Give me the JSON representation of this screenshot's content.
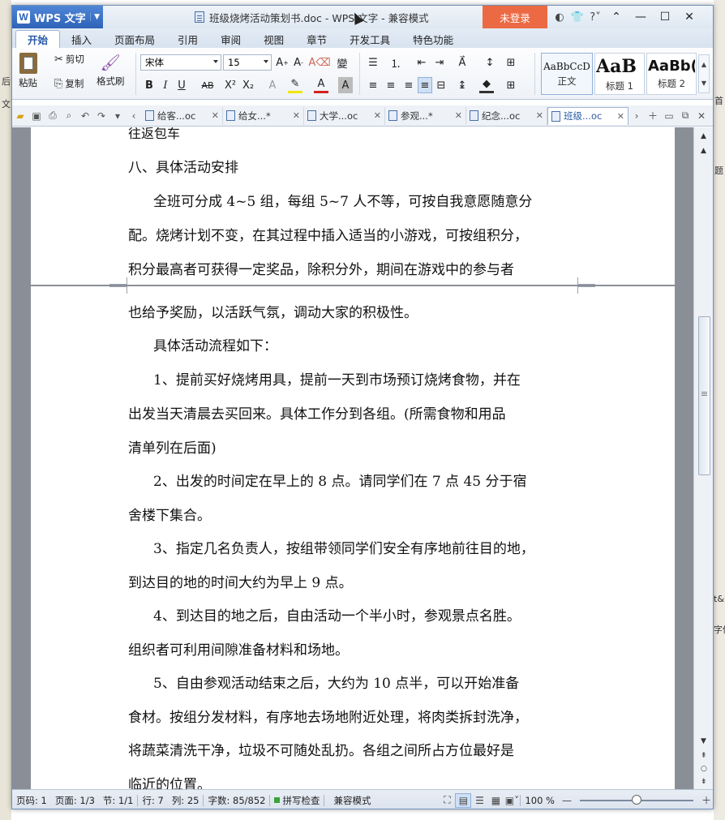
{
  "app": {
    "name": "WPS 文字",
    "window_title": "班级烧烤活动策划书.doc - WPS 文字 - 兼容模式",
    "login_label": "未登录"
  },
  "ribbon_tabs": [
    "开始",
    "插入",
    "页面布局",
    "引用",
    "审阅",
    "视图",
    "章节",
    "开发工具",
    "特色功能"
  ],
  "ribbon": {
    "paste": "粘贴",
    "cut": "剪切",
    "copy": "复制",
    "format_painter": "格式刷",
    "font_name": "宋体",
    "font_size": "15",
    "styles": [
      {
        "sample": "AaBbCcD",
        "name": "正文"
      },
      {
        "sample": "AaB",
        "name": "标题 1"
      },
      {
        "sample": "AaBb(",
        "name": "标题 2"
      }
    ]
  },
  "doc_tabs": [
    "给客...oc",
    "给女...*",
    "大学...oc",
    "参观...*",
    "纪念...oc",
    "班级...oc"
  ],
  "document": {
    "top_fragment": "往返包车",
    "heading": "八、具体活动安排",
    "page1_lines": [
      "全班可分成 4~5 组，每组 5~7 人不等，可按自我意愿随意分",
      "配。烧烤计划不变，在其过程中插入适当的小游戏，可按组积分，",
      "积分最高者可获得一定奖品，除积分外，期间在游戏中的参与者"
    ],
    "page2_lines": [
      "也给予奖励，以活跃气氛，调动大家的积极性。",
      "具体活动流程如下：",
      "1、提前买好烧烤用具，提前一天到市场预订烧烤食物，并在",
      "出发当天清晨去买回来。具体工作分到各组。(所需食物和用品",
      "清单列在后面)",
      "2、出发的时间定在早上的 8 点。请同学们在 7 点 45 分于宿",
      "舍楼下集合。",
      "3、指定几名负责人，按组带领同学们安全有序地前往目的地，",
      "到达目的地的时间大约为早上 9 点。",
      "4、到达目的地之后，自由活动一个半小时，参观景点名胜。",
      "组织者可利用间隙准备材料和场地。",
      "5、自由参观活动结束之后，大约为 10 点半，可以开始准备",
      "食材。按组分发材料，有序地去场地附近处理，将肉类拆封洗净，",
      "将蔬菜清洗干净，垃圾不可随处乱扔。各组之间所占方位最好是",
      "临近的位置。"
    ]
  },
  "status": {
    "page_code": "页码: 1",
    "pages": "页面: 1/3",
    "section": "节: 1/1",
    "row": "行: 7",
    "col": "列: 25",
    "word_count": "字数: 85/852",
    "spell_check": "拼写检查",
    "compat_mode": "兼容模式",
    "zoom": "100 %",
    "zoom_fraction": 0.5
  },
  "background": {
    "left_strip": [
      "后",
      "文"
    ],
    "right_strip": [
      "首",
      "题",
      "t&I",
      "字体"
    ]
  }
}
